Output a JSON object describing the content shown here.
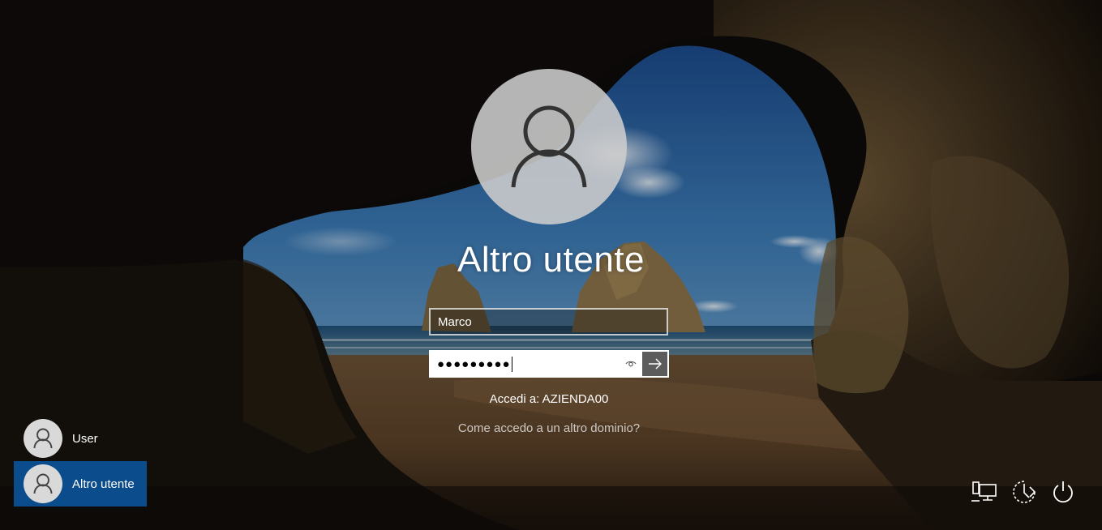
{
  "login": {
    "display_name": "Altro utente",
    "username_value": "Marco",
    "password_mask": "●●●●●●●●●",
    "signin_to": "Accedi a: AZIENDA00",
    "other_domain_link": "Come accedo a un altro dominio?"
  },
  "user_list": [
    {
      "name": "User",
      "selected": false
    },
    {
      "name": "Altro utente",
      "selected": true
    }
  ],
  "system_icons": [
    "network-icon",
    "ease-of-access-icon",
    "power-icon"
  ],
  "colors": {
    "selected_user_bg": "#0b4d8c",
    "submit_button_bg": "#5c5c5c"
  }
}
